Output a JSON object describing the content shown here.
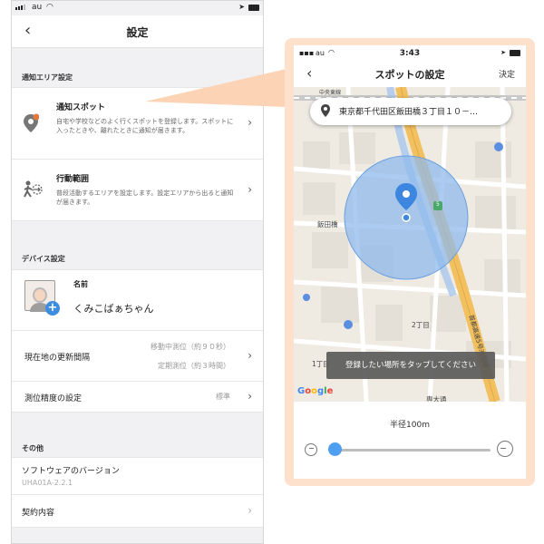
{
  "left": {
    "status": {
      "carrier": "au"
    },
    "nav": {
      "back": "‹",
      "title": "設定"
    },
    "sections": {
      "notify_area": "通知エリア設定",
      "device": "デバイス設定",
      "other": "その他"
    },
    "notify_spot": {
      "title": "通知スポット",
      "desc": "自宅や学校などのよく行くスポットを登録します。スポットに入ったときや、離れたときに通知が届きます。"
    },
    "activity_range": {
      "title": "行動範囲",
      "desc": "普段活動するエリアを設定します。設定エリアから出ると通知が届きます。"
    },
    "profile": {
      "name_label": "名前",
      "name_value": "くみこばぁちゃん"
    },
    "update_interval": {
      "label": "現在地の更新間隔",
      "moving": "移動中測位（約９０秒）",
      "fixed": "定期測位（約３時間）"
    },
    "accuracy": {
      "label": "測位精度の設定",
      "value": "標準"
    },
    "software": {
      "label": "ソフトウェアのバージョン",
      "version": "UHA01A-2.2.1"
    },
    "contract": {
      "label": "契約内容"
    }
  },
  "right": {
    "status": {
      "carrier": "au",
      "time": "3:43"
    },
    "nav": {
      "back": "‹",
      "title": "スポットの設定",
      "done": "決定"
    },
    "search": {
      "address": "東京都千代田区飯田橋３丁目１０－…"
    },
    "map": {
      "labels": [
        "中央東線",
        "飯田橋",
        "2丁目",
        "1丁目",
        "専大通",
        "首都高速5号池袋線",
        "5"
      ],
      "google": "Google",
      "toast": "登録したい場所をタップしてください"
    },
    "radius": {
      "label": "半径100m",
      "slider_fraction": 0.0
    }
  },
  "colors": {
    "accent": "#4e9ff0",
    "frame": "#fde1cc",
    "circle_fill": "#8fb9ec",
    "pin": "#3d86e0"
  }
}
